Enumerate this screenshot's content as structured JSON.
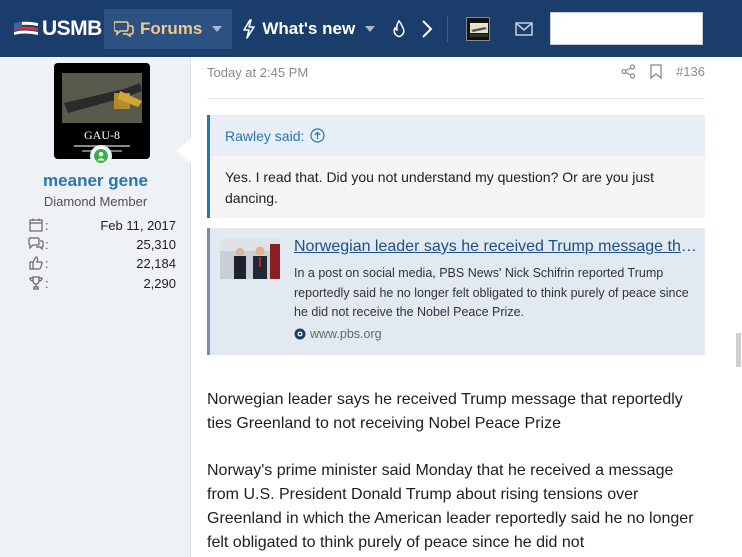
{
  "header": {
    "logo_text": "USMB",
    "nav": [
      {
        "label": "Forums",
        "active": true
      },
      {
        "label": "What's new",
        "active": false
      }
    ],
    "search_placeholder": ""
  },
  "user": {
    "name": "meaner gene",
    "title": "Diamond Member",
    "avatar_caption": "GAU-8",
    "stats": [
      {
        "icon": "calendar-icon",
        "value": "Feb 11, 2017"
      },
      {
        "icon": "messages-icon",
        "value": "25,310"
      },
      {
        "icon": "thumbs-up-icon",
        "value": "22,184"
      },
      {
        "icon": "trophy-icon",
        "value": "2,290"
      }
    ]
  },
  "post": {
    "timestamp": "Today at 2:45 PM",
    "number": "#136",
    "quote": {
      "author": "Rawley said:",
      "text": "Yes. I read that. Did you not understand my question? Or are you just dancing."
    },
    "unfurl": {
      "title": "Norwegian leader says he received Trump message that reportedly ties Greenland to not receiving Nobel Peace Prize",
      "description": "In a post on social media, PBS News' Nick Schifrin reported Trump reportedly said he no longer felt obligated to think purely of peace since he did not receive the Nobel Peace Prize.",
      "site": "www.pbs.org"
    },
    "paragraphs": [
      "Norwegian leader says he received Trump message that reportedly ties Greenland to not receiving Nobel Peace Prize",
      "Norway's prime minister said Monday that he received a message from U.S. President Donald Trump about rising tensions over Greenland in which the American leader reportedly said he no longer felt obligated to think purely of peace since he did not"
    ]
  },
  "colors": {
    "topbar": "#1b3d6b",
    "link": "#2577b1",
    "active_tab_text": "#f3c98a"
  }
}
